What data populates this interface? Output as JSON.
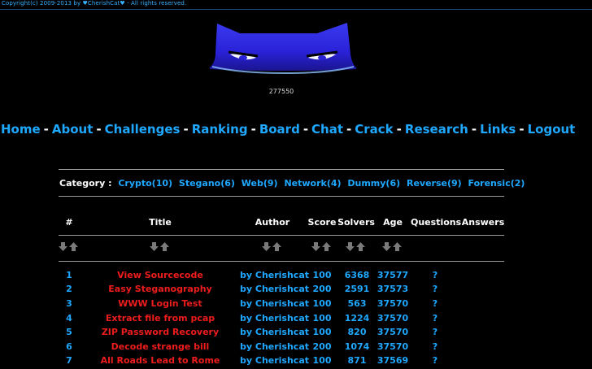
{
  "copyright": "Copyright(c) 2009-2013 by ♥CherishCat♥ - All rights reserved.",
  "visitor_count": "277550",
  "nav": [
    "Home",
    "About",
    "Challenges",
    "Ranking",
    "Board",
    "Chat",
    "Crack",
    "Research",
    "Links",
    "Logout"
  ],
  "nav_separator": "-",
  "category": {
    "label": "Category :",
    "items": [
      "Crypto(10)",
      "Stegano(6)",
      "Web(9)",
      "Network(4)",
      "Dummy(6)",
      "Reverse(9)",
      "Forensic(2)"
    ]
  },
  "table": {
    "headers": [
      "#",
      "Title",
      "Author",
      "Score",
      "Solvers",
      "Age",
      "Questions",
      "Answers"
    ],
    "rows": [
      {
        "num": "1",
        "title": "View Sourcecode",
        "author": "by Cherishcat",
        "score": "100",
        "solvers": "6368",
        "age": "37577",
        "q": "?"
      },
      {
        "num": "2",
        "title": "Easy Steganography",
        "author": "by Cherishcat",
        "score": "200",
        "solvers": "2591",
        "age": "37573",
        "q": "?"
      },
      {
        "num": "3",
        "title": "WWW Login Test",
        "author": "by Cherishcat",
        "score": "100",
        "solvers": "563",
        "age": "37570",
        "q": "?"
      },
      {
        "num": "4",
        "title": "Extract file from pcap",
        "author": "by Cherishcat",
        "score": "100",
        "solvers": "1224",
        "age": "37570",
        "q": "?"
      },
      {
        "num": "5",
        "title": "ZIP Password Recovery",
        "author": "by Cherishcat",
        "score": "100",
        "solvers": "820",
        "age": "37570",
        "q": "?"
      },
      {
        "num": "6",
        "title": "Decode strange bill",
        "author": "by Cherishcat",
        "score": "200",
        "solvers": "1074",
        "age": "37570",
        "q": "?"
      },
      {
        "num": "7",
        "title": "All Roads Lead to Rome",
        "author": "by Cherishcat",
        "score": "100",
        "solvers": "871",
        "age": "37569",
        "q": "?"
      }
    ]
  },
  "colors": {
    "link": "#1fa8ff",
    "title": "#ee1c1c",
    "background": "#000000"
  }
}
